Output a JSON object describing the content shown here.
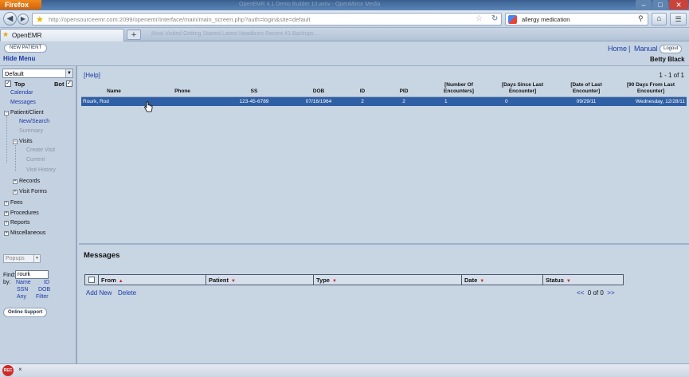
{
  "browser": {
    "app_button": "Firefox",
    "window_title": "OpenEMR 4.1 Demo Builder 10.wmv - OpenMirror Media",
    "url": "http://opensourceemr.com:2099/openemr/interface/main/main_screen.php?auth=login&site=default",
    "search_text": "allergy medication",
    "tab_title": "OpenEMR",
    "bookmarks_faded": "Most Visited   Getting Started   Latest Headlines   Recent 41   Backups   ..."
  },
  "header": {
    "new_patient_label": "NEW PATIENT",
    "hide_menu_label": "Hide Menu",
    "home_link": "Home",
    "separator": "|",
    "manual_link": "Manual",
    "logout_label": "Logout",
    "user_name": "Betty Black"
  },
  "nav": {
    "view_select": "Default",
    "top_label": "Top",
    "bot_label": "Bot",
    "calendar": "Calendar",
    "messages": "Messages",
    "patient_client": "Patient/Client",
    "new_search": "New/Search",
    "summary": "Summary",
    "visits": "Visits",
    "create_visit": "Create Visit",
    "current": "Current",
    "visit_history": "Visit History",
    "records": "Records",
    "visit_forms": "Visit Forms",
    "fees": "Fees",
    "procedures": "Procedures",
    "reports": "Reports",
    "miscellaneous": "Miscellaneous",
    "popups_select": "Popups",
    "find_label": "Find:",
    "find_value": "rourk",
    "by_label": "by:",
    "by_name": "Name",
    "by_id": "ID",
    "by_ssn": "SSN",
    "by_dob": "DOB",
    "by_any": "Any",
    "by_filter": "Filter",
    "online_support": "Online Support"
  },
  "results": {
    "help_link": "[Help]",
    "pagination": "1 - 1 of 1",
    "columns": [
      "Name",
      "Phone",
      "SS",
      "DOB",
      "ID",
      "PID",
      "[Number Of Encounters]",
      "[Days Since Last Encounter]",
      "[Date of Last Encounter]",
      "[90 Days From Last Encounter]"
    ],
    "rows": [
      [
        "Rourk, Rod",
        "",
        "123-45-6789",
        "07/16/1964",
        "2",
        "2",
        "1",
        "0",
        "09/29/11",
        "Wednesday, 12/28/11"
      ]
    ]
  },
  "messages": {
    "title": "Messages",
    "columns": [
      "From",
      "Patient",
      "Type",
      "Date",
      "Status"
    ],
    "add_new": "Add New",
    "delete": "Delete",
    "pager_prev": "<<",
    "pager_text": "0 of 0",
    "pager_next": ">>"
  },
  "statusbar": {
    "icon_text": "REC",
    "close": "×"
  },
  "colors": {
    "selected_row": "#2f5fa4",
    "link": "#1a39a5",
    "background": "#c8d5e3"
  }
}
